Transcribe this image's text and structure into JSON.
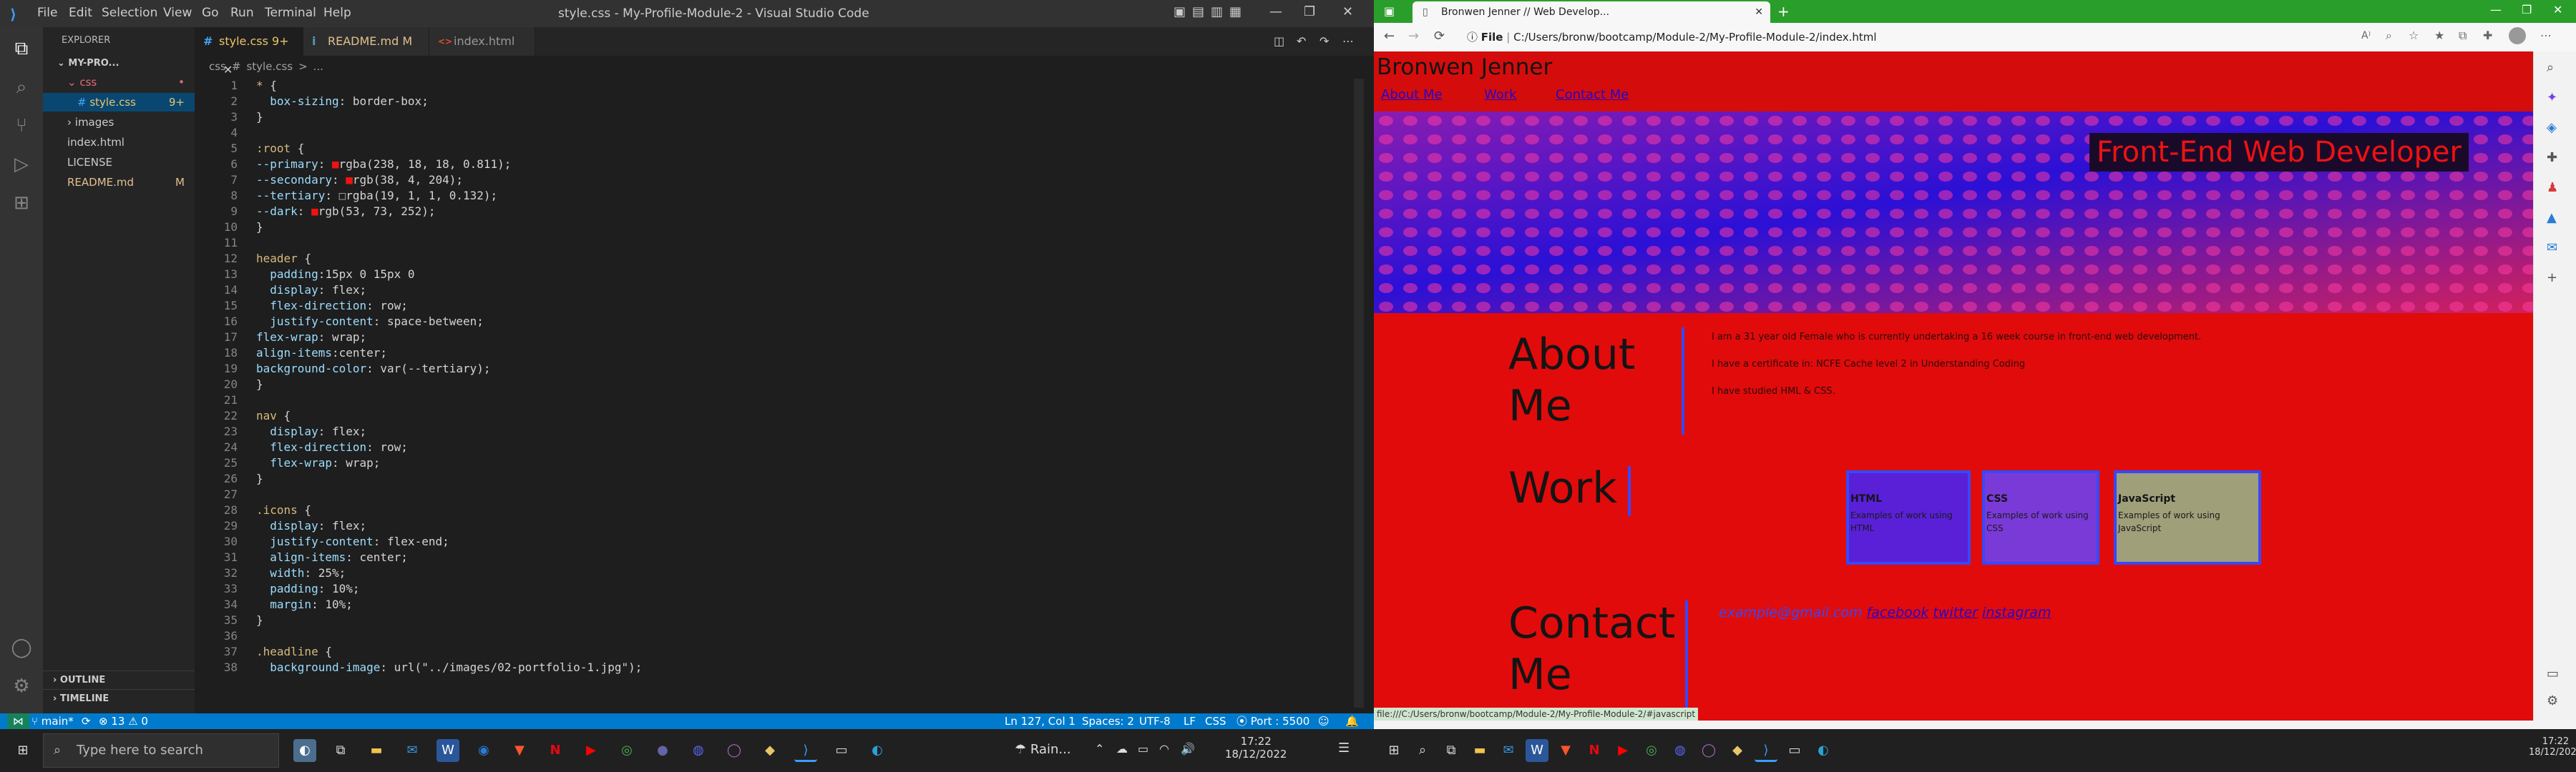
{
  "vscode": {
    "window_title": "style.css - My-Profile-Module-2 - Visual Studio Code",
    "menu": [
      "File",
      "Edit",
      "Selection",
      "View",
      "Go",
      "Run",
      "Terminal",
      "Help"
    ],
    "explorer_title": "EXPLORER",
    "folder": "MY-PRO...",
    "tree": [
      {
        "label": "css",
        "badge": "•",
        "indent": 1,
        "icon": "chevron-down"
      },
      {
        "label": "style.css",
        "badge": "9+",
        "indent": 2,
        "icon": "#"
      },
      {
        "label": "images",
        "badge": "",
        "indent": 1,
        "icon": "chevron-right"
      },
      {
        "label": "index.html",
        "badge": "",
        "indent": 1,
        "icon": ""
      },
      {
        "label": "LICENSE",
        "badge": "",
        "indent": 1,
        "icon": ""
      },
      {
        "label": "README.md",
        "badge": "M",
        "indent": 1,
        "icon": ""
      }
    ],
    "outline": "OUTLINE",
    "timeline": "TIMELINE",
    "tabs": [
      {
        "label": "style.css",
        "badge": "9+",
        "icon": "#"
      },
      {
        "label": "README.md",
        "badge": "M",
        "icon": "i"
      },
      {
        "label": "index.html",
        "badge": "",
        "icon": "<>"
      }
    ],
    "breadcrumb": [
      "css",
      "#",
      "style.css",
      ">",
      "..."
    ],
    "code": [
      "* {",
      "  box-sizing: border-box;",
      "}",
      "",
      ":root {",
      "--primary: ■rgba(238, 18, 18, 0.811);",
      "--secondary: ■rgb(38, 4, 204);",
      "--tertiary: □rgba(19, 1, 1, 0.132);",
      "--dark: ■rgb(53, 73, 252);",
      "}",
      "",
      "header {",
      "  padding:15px 0 15px 0",
      "  display: flex;",
      "  flex-direction: row;",
      "  justify-content: space-between;",
      "flex-wrap: wrap;",
      "align-items:center;",
      "background-color: var(--tertiary);",
      "}",
      "",
      "nav {",
      "  display: flex;",
      "  flex-direction: row;",
      "  flex-wrap: wrap;",
      "}",
      "",
      ".icons {",
      "  display: flex;",
      "  justify-content: flex-end;",
      "  align-items: center;",
      "  width: 25%;",
      "  padding: 10%;",
      "  margin: 10%;",
      "}",
      "",
      ".headline {",
      "  background-image: url(\"../images/02-portfolio-1.jpg\");"
    ],
    "status": {
      "branch": "main*",
      "errors": "⊗ 13 ⚠ 0",
      "position": "Ln 127, Col 1",
      "spaces": "Spaces: 2",
      "encoding": "UTF-8",
      "eol": "LF",
      "language": "CSS",
      "port": "Port : 5500"
    }
  },
  "browser": {
    "tab_title": "Bronwen Jenner // Web Develop...",
    "url_prefix": "File",
    "url": "C:/Users/bronw/bootcamp/Module-2/My-Profile-Module-2/index.html",
    "status_url": "file:///C:/Users/bronw/bootcamp/Module-2/My-Profile-Module-2/#javascript",
    "site": {
      "name": "Bronwen Jenner",
      "nav": [
        "About Me",
        "Work",
        "Contact Me"
      ],
      "headline": "Front-End Web Developer",
      "about_title": "About Me",
      "about_lines": [
        "I am a 31 year old Female who is currently undertaking a 16 week course in front-end web development.",
        "I have a certificate in: NCFE Cache level 2 in Understanding Coding",
        "I have studied HML & CSS."
      ],
      "work_title": "Work",
      "cards": [
        {
          "title": "HTML",
          "desc": "Examples of work using HTML"
        },
        {
          "title": "CSS",
          "desc": "Examples of work using CSS"
        },
        {
          "title": "JavaScript",
          "desc": "Examples of work using JavaScript"
        }
      ],
      "contact_title": "Contact Me",
      "contact_links": [
        "example@gmail.com",
        "facebook",
        "twitter",
        "instagram"
      ]
    }
  },
  "taskbar": {
    "search_placeholder": "Type here to search",
    "weather": "Rain...",
    "time": "17:22",
    "date": "18/12/2022"
  },
  "colors": {
    "primary": "#ee1212",
    "secondary": "#2604cc",
    "dark": "#3549fc",
    "vscode_blue": "#007acc"
  }
}
